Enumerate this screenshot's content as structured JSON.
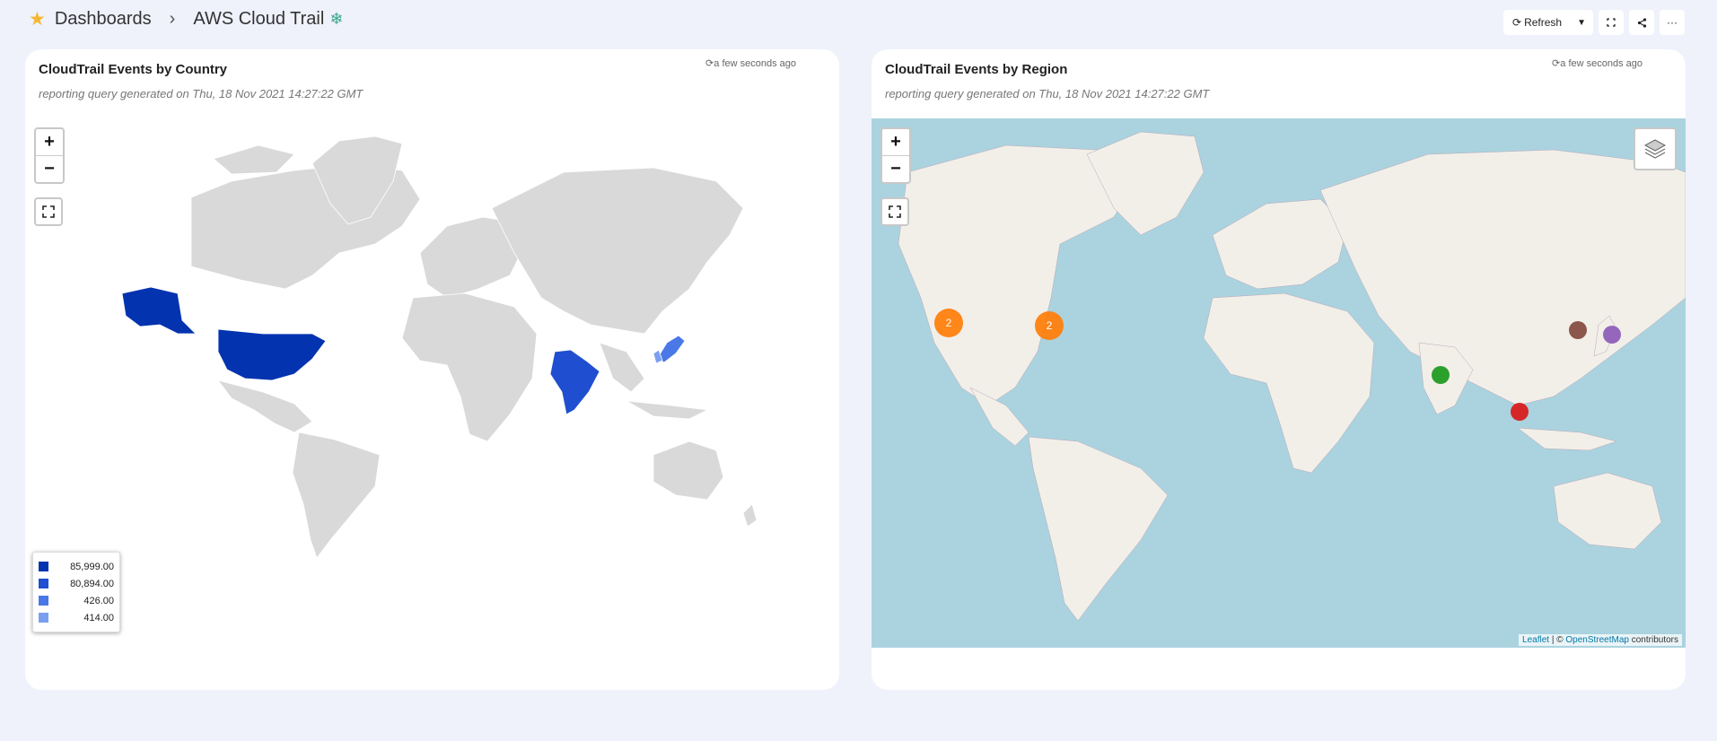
{
  "breadcrumb": {
    "root": "Dashboards",
    "current": "AWS Cloud Trail"
  },
  "toolbar": {
    "refresh_label": "Refresh"
  },
  "panels": {
    "country": {
      "title": "CloudTrail Events by Country",
      "subtitle": "reporting query generated on Thu, 18 Nov 2021 14:27:22 GMT",
      "timestamp": "a few seconds ago",
      "legend": [
        {
          "value": "85,999.00",
          "color": "#0433b0"
        },
        {
          "value": "80,894.00",
          "color": "#1f4fd0"
        },
        {
          "value": "426.00",
          "color": "#4a78e6"
        },
        {
          "value": "414.00",
          "color": "#7b9ff0"
        }
      ]
    },
    "region": {
      "title": "CloudTrail Events by Region",
      "subtitle": "reporting query generated on Thu, 18 Nov 2021 14:27:22 GMT",
      "timestamp": "a few seconds ago",
      "cluster_count_west": "2",
      "cluster_count_east": "2",
      "attribution": {
        "leaflet": "Leaflet",
        "sep": " | © ",
        "osm": "OpenStreetMap",
        "suffix": " contributors"
      }
    }
  },
  "colors": {
    "land_grey": "#d9d9d9",
    "ocean": "#aad3df",
    "land_osm": "#f2efe9",
    "cluster_orange": "#ff7f0e",
    "marker_green": "#2ca02c",
    "marker_red": "#d62728",
    "marker_brown": "#8c564b",
    "marker_purple": "#9467bd"
  }
}
